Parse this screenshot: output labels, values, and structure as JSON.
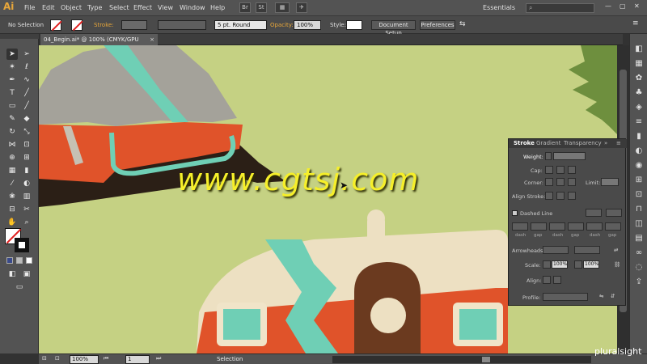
{
  "app": {
    "logo": "Ai",
    "workspace": "Essentials"
  },
  "menu": [
    "File",
    "Edit",
    "Object",
    "Type",
    "Select",
    "Effect",
    "View",
    "Window",
    "Help"
  ],
  "menubar_boxes": [
    "Br",
    "St"
  ],
  "control": {
    "selection": "No Selection",
    "stroke_label": "Stroke:",
    "brush_value": "5 pt. Round",
    "opacity_label": "Opacity:",
    "opacity_value": "100%",
    "style_label": "Style:",
    "document_setup": "Document Setup",
    "preferences": "Preferences"
  },
  "document": {
    "tab_title": "04_Begin.ai* @ 100% (CMYK/GPU Preview)",
    "tab_close": "×"
  },
  "stroke_panel": {
    "tabs": [
      "Stroke",
      "Gradient",
      "Transparency"
    ],
    "weight_label": "Weight:",
    "cap_label": "Cap:",
    "corner_label": "Corner:",
    "limit_label": "Limit:",
    "align_label": "Align Stroke:",
    "dashed_label": "Dashed Line",
    "dash_labels": [
      "dash",
      "gap",
      "dash",
      "gap",
      "dash",
      "gap"
    ],
    "arrowheads_label": "Arrowheads:",
    "scale_label": "Scale:",
    "scale_value1": "100%",
    "scale_value2": "100%",
    "align2_label": "Align:",
    "profile_label": "Profile:"
  },
  "status": {
    "zoom": "100%",
    "artboard": "1",
    "tool": "Selection"
  },
  "watermark": "www.cgtsj.com",
  "brand": "pluralsight",
  "colors": {
    "canvas": "#c5d183",
    "tent_gray": "#a4a29a",
    "tent_teal": "#6fcfb5",
    "tent_orange": "#e0532a",
    "tent_dark": "#2b1f16",
    "trailer_cream": "#ede0c2",
    "wood": "#6b3a1f",
    "tree_green": "#6e8f3e",
    "watermark": "#f6ef2a"
  }
}
